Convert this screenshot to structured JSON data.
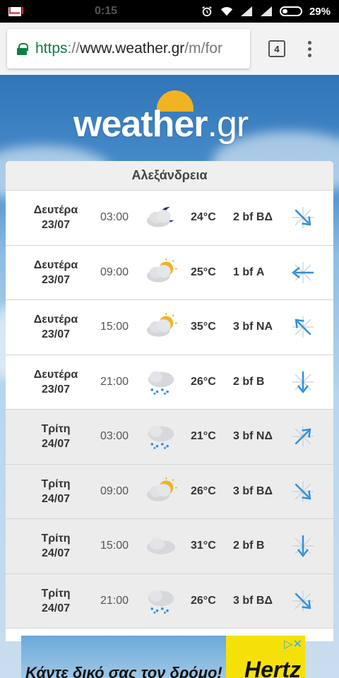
{
  "status": {
    "time": "0:15",
    "battery": "29%"
  },
  "browser": {
    "url_scheme": "https",
    "url_sep": "://",
    "url_host": "www.weather.gr",
    "url_path": "/m/for",
    "tab_count": "4"
  },
  "logo": {
    "main": "weather",
    "tld": ".gr"
  },
  "forecast": {
    "location": "Αλεξάνδρεια",
    "rows": [
      {
        "day": "Δευτέρα",
        "date": "23/07",
        "time": "03:00",
        "icon": "moon-cloud-icon",
        "temp": "24°C",
        "wind": "2 bf ΒΔ",
        "arrow": "arrow-southeast-icon"
      },
      {
        "day": "Δευτέρα",
        "date": "23/07",
        "time": "09:00",
        "icon": "sun-cloud-icon",
        "temp": "25°C",
        "wind": "1 bf Α",
        "arrow": "arrow-west-icon"
      },
      {
        "day": "Δευτέρα",
        "date": "23/07",
        "time": "15:00",
        "icon": "sun-cloud-icon",
        "temp": "35°C",
        "wind": "3 bf ΝΑ",
        "arrow": "arrow-northwest-icon"
      },
      {
        "day": "Δευτέρα",
        "date": "23/07",
        "time": "21:00",
        "icon": "rain-cloud-icon",
        "temp": "26°C",
        "wind": "2 bf Β",
        "arrow": "arrow-south-icon"
      },
      {
        "day": "Τρίτη",
        "date": "24/07",
        "time": "03:00",
        "icon": "rain-cloud-icon",
        "temp": "21°C",
        "wind": "3 bf ΝΔ",
        "arrow": "arrow-northeast-icon"
      },
      {
        "day": "Τρίτη",
        "date": "24/07",
        "time": "09:00",
        "icon": "sun-cloud-icon",
        "temp": "26°C",
        "wind": "3 bf ΒΔ",
        "arrow": "arrow-southeast-icon"
      },
      {
        "day": "Τρίτη",
        "date": "24/07",
        "time": "15:00",
        "icon": "cloud-icon",
        "temp": "31°C",
        "wind": "2 bf Β",
        "arrow": "arrow-south-icon"
      },
      {
        "day": "Τρίτη",
        "date": "24/07",
        "time": "21:00",
        "icon": "rain-cloud-icon",
        "temp": "26°C",
        "wind": "3 bf ΒΔ",
        "arrow": "arrow-southeast-icon"
      }
    ]
  },
  "ad": {
    "text": "Κάντε δικό σας τον δρόμο!",
    "brand": "Hertz"
  },
  "colors": {
    "accent_green": "#0b8043",
    "arrow_blue": "#2e8fdc",
    "sun": "#f0b323"
  }
}
